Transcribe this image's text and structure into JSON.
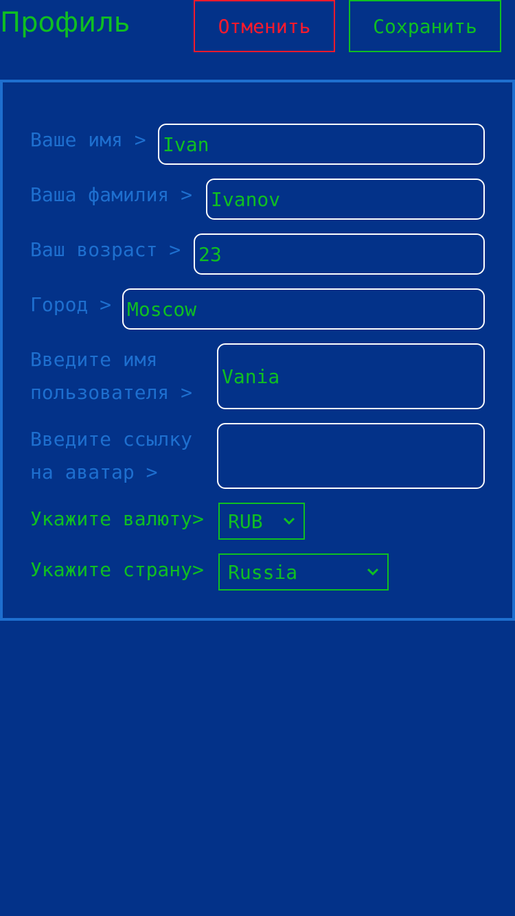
{
  "header": {
    "title": "Профиль",
    "cancel_label": "Отменить",
    "save_label": "Сохранить"
  },
  "form": {
    "first_name": {
      "label": "Ваше имя >",
      "value": "Ivan"
    },
    "last_name": {
      "label": "Ваша фамилия >",
      "value": "Ivanov"
    },
    "age": {
      "label": "Ваш возраст >",
      "value": "23"
    },
    "city": {
      "label": "Город >",
      "value": "Moscow"
    },
    "username": {
      "label": "Введите имя\nпользователя >",
      "value": "Vania"
    },
    "avatar": {
      "label": "Введите ссылку\nна аватар >",
      "value": ""
    },
    "currency": {
      "label": "Укажите валюту>",
      "selected": "RUB"
    },
    "country": {
      "label": "Укажите страну>",
      "selected": "Russia"
    }
  },
  "icons": {
    "select_arrow": "chevron-down-icon"
  },
  "colors": {
    "background": "#033289",
    "accent_green": "#0fbf22",
    "cancel_red": "#ff1a2c",
    "label_blue": "#1e6fcf",
    "input_border": "#ffffff"
  }
}
